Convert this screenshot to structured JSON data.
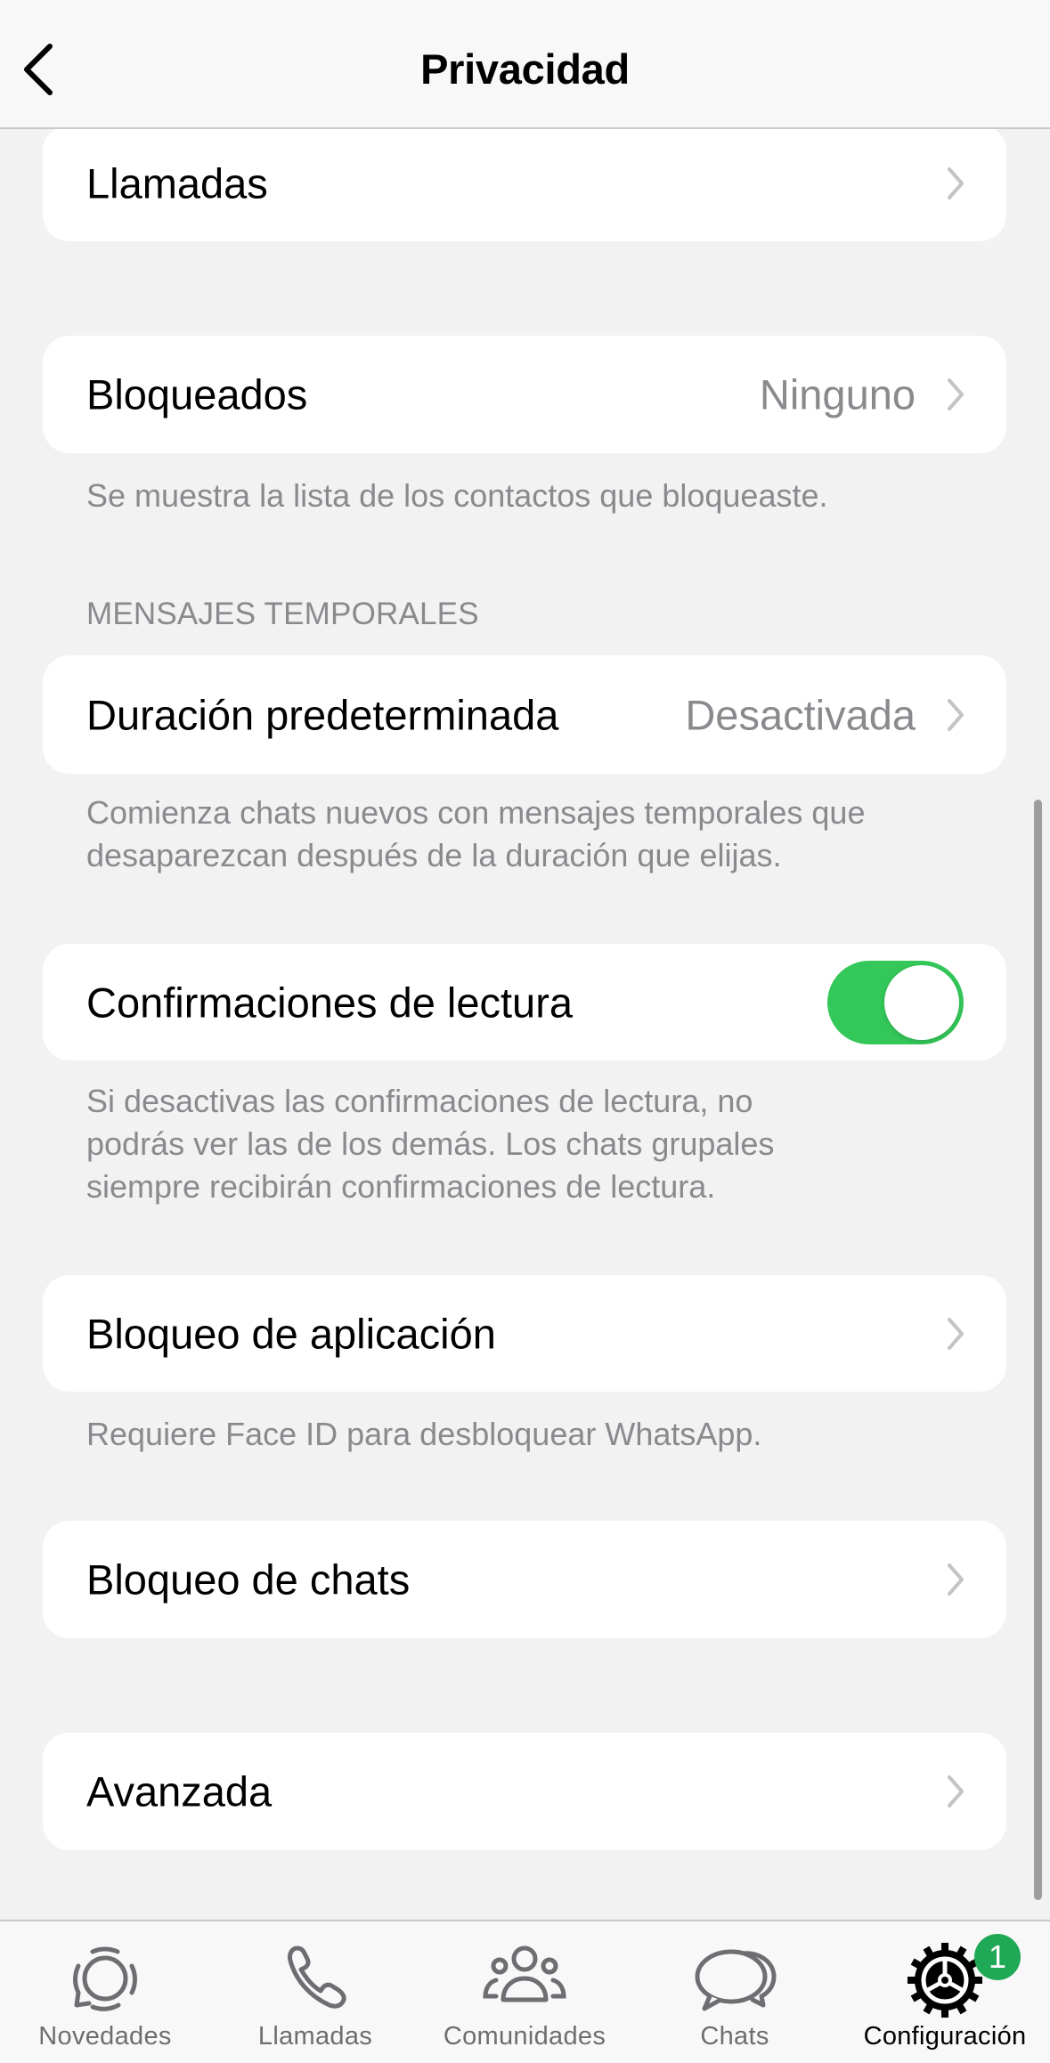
{
  "header": {
    "title": "Privacidad",
    "back_icon": "chevron-left-icon"
  },
  "rows": {
    "llamadas": {
      "label": "Llamadas"
    },
    "bloqueados": {
      "label": "Bloqueados",
      "value": "Ninguno",
      "footer": "Se muestra la lista de los contactos que bloqueaste."
    },
    "temporales_header": "MENSAJES TEMPORALES",
    "duracion": {
      "label": "Duración predeterminada",
      "value": "Desactivada",
      "footer_1": "Comienza chats nuevos con mensajes temporales que",
      "footer_2": "desaparezcan después de la duración que elijas."
    },
    "confirmaciones": {
      "label": "Confirmaciones de lectura",
      "toggle_on": true,
      "footer_1": "Si desactivas las confirmaciones de lectura, no",
      "footer_2": "podrás ver las de los demás. Los chats grupales",
      "footer_3": "siempre recibirán confirmaciones de lectura."
    },
    "bloqueo_app": {
      "label": "Bloqueo de aplicación",
      "footer": "Requiere Face ID para desbloquear WhatsApp."
    },
    "bloqueo_chats": {
      "label": "Bloqueo de chats"
    },
    "avanzada": {
      "label": "Avanzada"
    }
  },
  "tabbar": {
    "tabs": [
      {
        "label": "Novedades",
        "icon": "updates-icon"
      },
      {
        "label": "Llamadas",
        "icon": "phone-icon"
      },
      {
        "label": "Comunidades",
        "icon": "communities-icon"
      },
      {
        "label": "Chats",
        "icon": "chats-icon"
      },
      {
        "label": "Configuración",
        "icon": "settings-gear-icon",
        "active": true,
        "badge": "1"
      }
    ]
  },
  "colors": {
    "toggle_on": "#34c759",
    "badge": "#1fa855",
    "background": "#f2f2f3"
  }
}
